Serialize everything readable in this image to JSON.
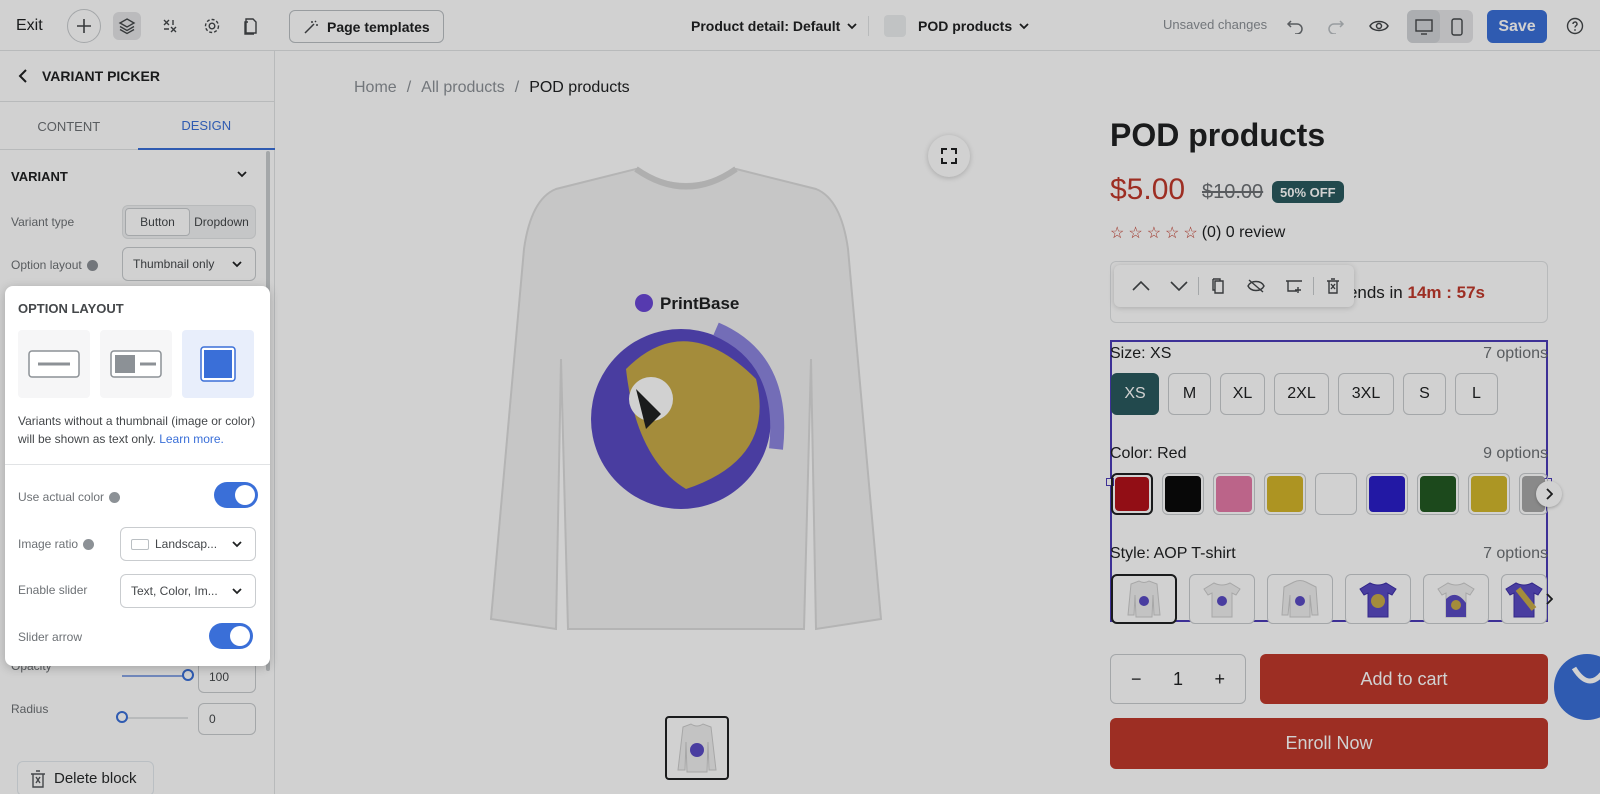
{
  "topbar": {
    "exit_label": "Exit",
    "page_templates_label": "Page templates",
    "page_selector": "Product detail: Default",
    "product_selector": "POD products",
    "unsaved_label": "Unsaved changes",
    "save_label": "Save"
  },
  "sidebar": {
    "title": "VARIANT PICKER",
    "tabs": [
      "CONTENT",
      "DESIGN"
    ],
    "active_tab": "DESIGN",
    "section_title": "VARIANT",
    "variant_type_label": "Variant type",
    "variant_type_options": [
      "Button",
      "Dropdown"
    ],
    "variant_type_selected": "Button",
    "option_layout_label": "Option layout",
    "option_layout_value": "Thumbnail only",
    "popover": {
      "title": "OPTION LAYOUT",
      "description": "Variants without a thumbnail (image or color) will be shown as text only.",
      "learn_more": "Learn more.",
      "use_actual_color_label": "Use actual color",
      "use_actual_color_on": true,
      "image_ratio_label": "Image ratio",
      "image_ratio_value": "Landscap...",
      "enable_slider_label": "Enable slider",
      "enable_slider_value": "Text, Color, Im...",
      "slider_arrow_label": "Slider arrow",
      "slider_arrow_on": true
    },
    "opacity_label": "Opacity",
    "opacity_value": "100",
    "opacity_fraction": 1.0,
    "radius_label": "Radius",
    "radius_value": "0",
    "radius_fraction": 0.0,
    "delete_label": "Delete block"
  },
  "canvas": {
    "breadcrumb": [
      "Home",
      "/",
      "All products",
      "/",
      "POD products"
    ],
    "shirt_brand": "PrintBase",
    "product_title": "POD products",
    "price": "$5.00",
    "old_price": "$10.00",
    "discount_badge": "50% OFF",
    "rating_text": "(0) 0 review",
    "rating_stars": 0,
    "timer_prefix": "e ends in",
    "timer_value": "14m : 57s",
    "size": {
      "label": "Size: XS",
      "count": "7 options",
      "options": [
        "XS",
        "M",
        "XL",
        "2XL",
        "3XL",
        "S",
        "L"
      ],
      "selected": "XS"
    },
    "color": {
      "label": "Color: Red",
      "count": "9 options",
      "swatches": [
        "#b3121a",
        "#0a0a0a",
        "#e57aa8",
        "#d4b52a",
        "#ffffff",
        "#2a1ec8",
        "#235a23",
        "#d2b82c",
        "#a8a8a8"
      ],
      "selected_index": 0
    },
    "style": {
      "label": "Style: AOP T-shirt",
      "count": "7 options"
    },
    "quantity": "1",
    "qty_minus": "−",
    "qty_plus": "+",
    "add_to_cart": "Add to cart",
    "enroll": "Enroll Now"
  },
  "colors": {
    "accent": "#3a6fd8",
    "buy_button": "#c0392b",
    "badge": "#2a5a5e",
    "selection": "#4b3bb8"
  }
}
